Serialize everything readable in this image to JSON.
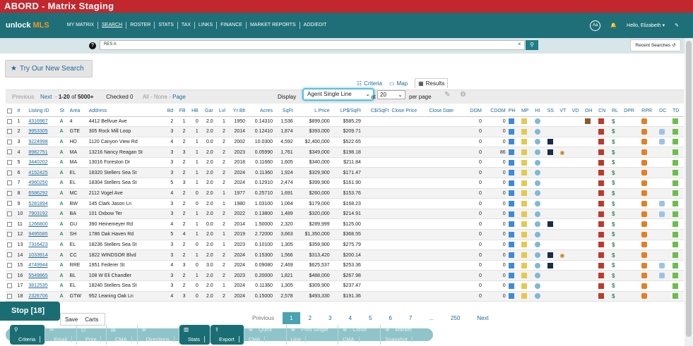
{
  "app": {
    "title": "ABORD - Matrix Staging"
  },
  "nav": {
    "logo_main": "unlock",
    "logo_accent": "MLS",
    "items": [
      "MY MATRIX",
      "SEARCH",
      "ROSTER",
      "STATS",
      "TAX",
      "LINKS",
      "FINANCE",
      "MARKET REPORTS",
      "ADD/EDIT"
    ],
    "aa_label": "Aa",
    "user_greeting": "Hello, Elizabeth"
  },
  "search": {
    "value": "RES A",
    "recent_label": "Recent Searches"
  },
  "try_new_search": "Try Our New Search",
  "views": {
    "criteria": "Criteria",
    "map": "Map",
    "results": "Results"
  },
  "toolbar": {
    "previous": "Previous",
    "next": "Next",
    "range": "1-20",
    "of_label": "of",
    "total": "5000+",
    "checked_label": "Checked",
    "checked_count": "0",
    "all": "All",
    "none": "None",
    "page": "Page",
    "display_label": "Display",
    "display_value": "Agent Single Line",
    "at_label": "at",
    "per_page_value": "20",
    "per_page_label": "per page"
  },
  "columns": [
    "#",
    "Listing ID",
    "St",
    "Area",
    "Address",
    "Bd",
    "FB",
    "HB",
    "Gar",
    "Lvl",
    "Yr Blt",
    "Acres",
    "SqFt",
    "L Price",
    "LP$/SqFt",
    "C$/SqFt",
    "Close Price",
    "Close Date",
    "DOM",
    "CDOM",
    "PH",
    "MP",
    "HI",
    "SS",
    "VT",
    "VD",
    "OH",
    "CN",
    "RL",
    "DPR",
    "RPR",
    "DC",
    "TD"
  ],
  "rows": [
    {
      "n": "1",
      "id": "4316967",
      "st": "A",
      "area": "4",
      "addr": "4412 Bellvue Ave",
      "bd": "2",
      "fb": "1",
      "hb": "0",
      "gar": "2.0",
      "lvl": "1",
      "yr": "1950",
      "acres": "0.14310",
      "sqft": "1,536",
      "lp": "$899,000",
      "lpsf": "$585.29",
      "dom": "0",
      "cdom": "0"
    },
    {
      "n": "2",
      "id": "9953305",
      "st": "A",
      "area": "GTE",
      "addr": "305 Rock Mill Loop",
      "bd": "3",
      "fb": "2",
      "hb": "1",
      "gar": "2.0",
      "lvl": "2",
      "yr": "2014",
      "acres": "0.12410",
      "sqft": "1,874",
      "lp": "$393,000",
      "lpsf": "$209.71",
      "dom": "0",
      "cdom": "0"
    },
    {
      "n": "3",
      "id": "9224998",
      "st": "A",
      "area": "HD",
      "addr": "1120 Canyon View Rd",
      "bd": "4",
      "fb": "2",
      "hb": "1",
      "gar": "0.0",
      "lvl": "2",
      "yr": "2002",
      "acres": "10.0300",
      "sqft": "4,592",
      "lp": "$2,400,000",
      "lpsf": "$522.65",
      "dom": "0",
      "cdom": "0"
    },
    {
      "n": "4",
      "id": "8982751",
      "st": "A",
      "area": "MA",
      "addr": "13216 Nancy Reagan St",
      "bd": "3",
      "fb": "3",
      "hb": "1",
      "gar": "2.0",
      "lvl": "2",
      "yr": "2023",
      "acres": "0.05990",
      "sqft": "1,761",
      "lp": "$349,000",
      "lpsf": "$198.18",
      "dom": "0",
      "cdom": "86"
    },
    {
      "n": "5",
      "id": "3440202",
      "st": "A",
      "area": "MA",
      "addr": "13016 Foreston Dr",
      "bd": "3",
      "fb": "2",
      "hb": "1",
      "gar": "2.0",
      "lvl": "2",
      "yr": "2018",
      "acres": "0.11660",
      "sqft": "1,605",
      "lp": "$340,000",
      "lpsf": "$211.84",
      "dom": "0",
      "cdom": "0"
    },
    {
      "n": "6",
      "id": "4152425",
      "st": "A",
      "area": "EL",
      "addr": "18320 Stellers Sea St",
      "bd": "3",
      "fb": "2",
      "hb": "1",
      "gar": "2.0",
      "lvl": "2",
      "yr": "2024",
      "acres": "0.11360",
      "sqft": "1,924",
      "lp": "$329,900",
      "lpsf": "$171.47",
      "dom": "0",
      "cdom": "0"
    },
    {
      "n": "7",
      "id": "4960250",
      "st": "A",
      "area": "EL",
      "addr": "18304 Stellers Sea St",
      "bd": "5",
      "fb": "3",
      "hb": "1",
      "gar": "2.0",
      "lvl": "2",
      "yr": "2024",
      "acres": "0.12910",
      "sqft": "2,474",
      "lp": "$399,900",
      "lpsf": "$161.90",
      "dom": "0",
      "cdom": "0"
    },
    {
      "n": "8",
      "id": "6586292",
      "st": "A",
      "area": "MC",
      "addr": "2112 Vogel Ave",
      "bd": "4",
      "fb": "2",
      "hb": "0",
      "gar": "2.0",
      "lvl": "1",
      "yr": "1977",
      "acres": "0.25710",
      "sqft": "1,691",
      "lp": "$260,000",
      "lpsf": "$153.76",
      "dom": "0",
      "cdom": "0"
    },
    {
      "n": "9",
      "id": "5281894",
      "st": "A",
      "area": "BW",
      "addr": "145 Clark Jason Ln",
      "bd": "3",
      "fb": "2",
      "hb": "0",
      "gar": "2.0",
      "lvl": "1",
      "yr": "1980",
      "acres": "1.03100",
      "sqft": "1,064",
      "lp": "$179,000",
      "lpsf": "$168.23",
      "dom": "0",
      "cdom": "0"
    },
    {
      "n": "10",
      "id": "7903192",
      "st": "A",
      "area": "BA",
      "addr": "101 Oxbow Ter",
      "bd": "3",
      "fb": "2",
      "hb": "1",
      "gar": "2.0",
      "lvl": "2",
      "yr": "2022",
      "acres": "0.13800",
      "sqft": "1,489",
      "lp": "$320,000",
      "lpsf": "$214.91",
      "dom": "0",
      "cdom": "0"
    },
    {
      "n": "11",
      "id": "1266800",
      "st": "A",
      "area": "GU",
      "addr": "390 Heinemeyer Rd",
      "bd": "4",
      "fb": "2",
      "hb": "1",
      "gar": "0.0",
      "lvl": "2",
      "yr": "2014",
      "acres": "1.50000",
      "sqft": "2,320",
      "lp": "$289,999",
      "lpsf": "$125.00",
      "dom": "0",
      "cdom": "0"
    },
    {
      "n": "12",
      "id": "9495585",
      "st": "A",
      "area": "SH",
      "addr": "1786 Oak Haven Rd",
      "bd": "5",
      "fb": "4",
      "hb": "1",
      "gar": "2.0",
      "lvl": "1",
      "yr": "2019",
      "acres": "2.72000",
      "sqft": "3,663",
      "lp": "$1,350,000",
      "lpsf": "$368.55",
      "dom": "0",
      "cdom": "0"
    },
    {
      "n": "13",
      "id": "7316423",
      "st": "A",
      "area": "EL",
      "addr": "18236 Stellers Sea St",
      "bd": "3",
      "fb": "2",
      "hb": "0",
      "gar": "2.0",
      "lvl": "1",
      "yr": "2023",
      "acres": "0.10100",
      "sqft": "1,305",
      "lp": "$359,900",
      "lpsf": "$275.79",
      "dom": "0",
      "cdom": "0"
    },
    {
      "n": "14",
      "id": "1033914",
      "st": "A",
      "area": "CC",
      "addr": "1822 WINDSOR Blvd",
      "bd": "3",
      "fb": "2",
      "hb": "1",
      "gar": "2.0",
      "lvl": "2",
      "yr": "2024",
      "acres": "0.15300",
      "sqft": "1,566",
      "lp": "$313,420",
      "lpsf": "$200.14",
      "dom": "0",
      "cdom": "0"
    },
    {
      "n": "15",
      "id": "4749944",
      "st": "A",
      "area": "RRE",
      "addr": "1951 Federer St",
      "bd": "4",
      "fb": "3",
      "hb": "0",
      "gar": "3.0",
      "lvl": "2",
      "yr": "2024",
      "acres": "0.09080",
      "sqft": "2,469",
      "lp": "$625,537",
      "lpsf": "$253.36",
      "dom": "0",
      "cdom": "0"
    },
    {
      "n": "16",
      "id": "5549865",
      "st": "A",
      "area": "BL",
      "addr": "108 W Eli Chandler",
      "bd": "3",
      "fb": "2",
      "hb": "1",
      "gar": "2.0",
      "lvl": "2",
      "yr": "2023",
      "acres": "0.20000",
      "sqft": "1,821",
      "lp": "$488,000",
      "lpsf": "$267.98",
      "dom": "0",
      "cdom": "0"
    },
    {
      "n": "17",
      "id": "3812535",
      "st": "A",
      "area": "EL",
      "addr": "18240 Stellers Sea St",
      "bd": "3",
      "fb": "2",
      "hb": "0",
      "gar": "2.0",
      "lvl": "1",
      "yr": "2024",
      "acres": "0.11360",
      "sqft": "1,305",
      "lp": "$309,900",
      "lpsf": "$237.47",
      "dom": "0",
      "cdom": "0"
    },
    {
      "n": "18",
      "id": "2326706",
      "st": "A",
      "area": "GTW",
      "addr": "952 Leaning Oak Ln",
      "bd": "4",
      "fb": "3",
      "hb": "0",
      "gar": "2.0",
      "lvl": "2",
      "yr": "2024",
      "acres": "0.15000",
      "sqft": "2,578",
      "lp": "$493,330",
      "lpsf": "$191.36",
      "dom": "0",
      "cdom": "0"
    }
  ],
  "stop_button": "Stop [18]",
  "save": "Save",
  "carts": "Carts",
  "pager": {
    "previous": "Previous",
    "pages": [
      "1",
      "2",
      "3",
      "4",
      "5",
      "6",
      "7"
    ],
    "ellipsis": "...",
    "last": "250",
    "next": "Next"
  },
  "actions": [
    "Criteria",
    "Email",
    "Print",
    "CMA",
    "Directions",
    "Stats",
    "Export",
    "Quick CMA",
    "Print Single Line",
    "Cloud CMA",
    "Market Snapshot"
  ]
}
